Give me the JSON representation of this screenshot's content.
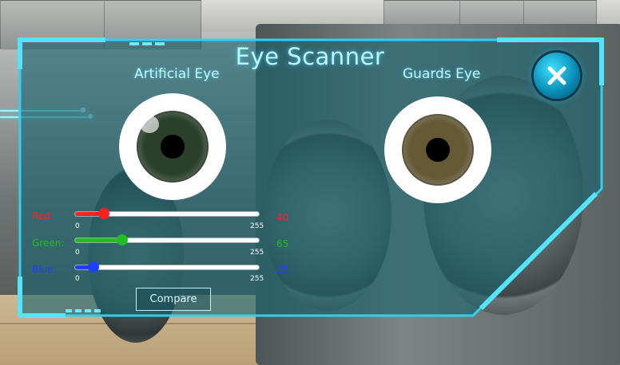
{
  "title": "Eye Scanner",
  "eyes": {
    "artificial": {
      "label": "Artificial Eye",
      "iris_color": "#284128"
    },
    "guards": {
      "label": "Guards Eye",
      "iris_color": "#655a35"
    }
  },
  "sliders": [
    {
      "key": "red",
      "label": "Red:",
      "value": "40",
      "fraction": 0.157,
      "min": "0",
      "max": "255",
      "color": "#ff2020"
    },
    {
      "key": "green",
      "label": "Green:",
      "value": "65",
      "fraction": 0.255,
      "min": "0",
      "max": "255",
      "color": "#1fbf1f"
    },
    {
      "key": "blue",
      "label": "Blue:",
      "value": "25",
      "fraction": 0.098,
      "min": "0",
      "max": "255",
      "color": "#1f3fff"
    }
  ],
  "buttons": {
    "compare": "Compare",
    "close_icon": "close-x-icon"
  },
  "colors": {
    "accent": "#2ecbf0",
    "panel": "#1f5f6d"
  }
}
